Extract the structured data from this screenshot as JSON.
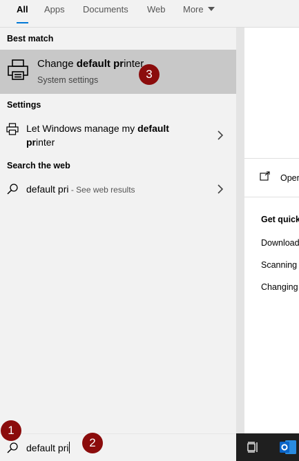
{
  "tabs": [
    {
      "label": "All",
      "active": true
    },
    {
      "label": "Apps",
      "active": false
    },
    {
      "label": "Documents",
      "active": false
    },
    {
      "label": "Web",
      "active": false
    },
    {
      "label": "More",
      "active": false
    }
  ],
  "sections": {
    "best_match": "Best match",
    "settings": "Settings",
    "search_web": "Search the web"
  },
  "best_match": {
    "icon": "printer-icon",
    "title_pre": "Change ",
    "title_bold1": "default",
    "title_mid": " ",
    "title_bold2": "pr",
    "title_post": "inter",
    "subtitle": "System settings"
  },
  "settings_result": {
    "icon": "printer-icon",
    "line1_pre": "Let Windows manage my ",
    "line1_bold": "default",
    "line2_bold": "pr",
    "line2_post": "inter"
  },
  "web_result": {
    "icon": "search-icon",
    "query": "default pri",
    "suffix": " - See web results"
  },
  "preview": {
    "open_label": "Oper",
    "get_quick": "Get quick",
    "links": [
      "Download",
      "Scanning",
      "Changing"
    ]
  },
  "search": {
    "value": "default pri"
  },
  "callouts": [
    "1",
    "2",
    "3"
  ],
  "colors": {
    "selected_row": "#c8c8c8",
    "callout": "#8b0c0c",
    "taskbar": "#1f1f1f",
    "outlook": "#0a64c8"
  }
}
